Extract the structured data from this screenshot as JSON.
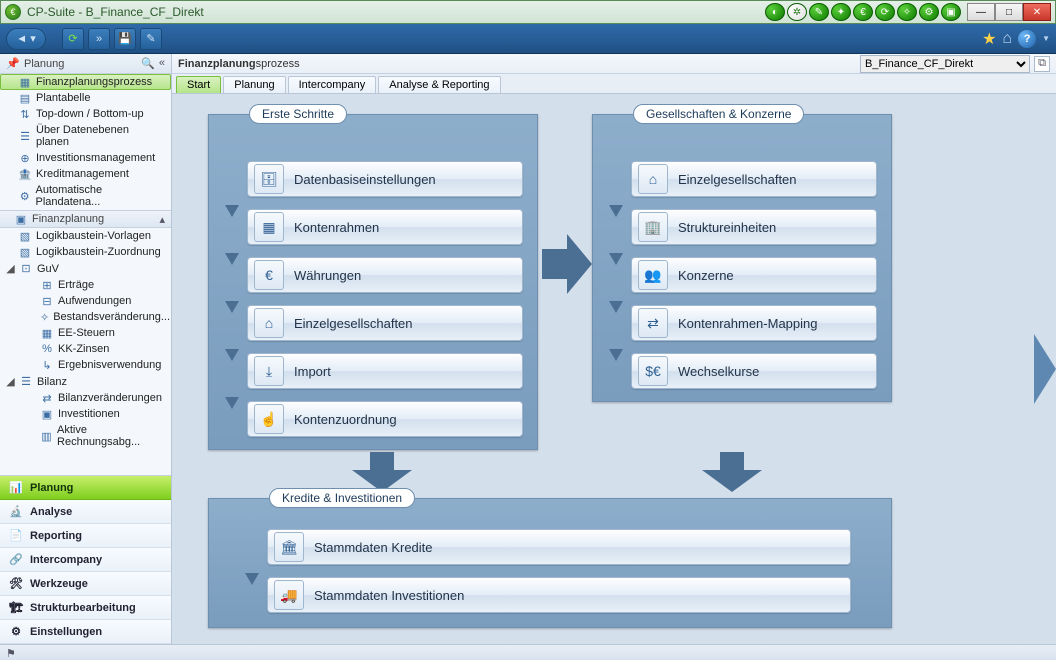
{
  "window": {
    "title": "CP-Suite - B_Finance_CF_Direkt"
  },
  "toolbar_icons": {
    "star": "★",
    "home": "⌂",
    "help": "?"
  },
  "sidebar": {
    "header": "Planung",
    "items": [
      {
        "label": "Finanzplanungsprozess",
        "selected": true,
        "icon": "process"
      },
      {
        "label": "Plantabelle",
        "icon": "table"
      },
      {
        "label": "Top-down / Bottom-up",
        "icon": "updown"
      },
      {
        "label": "Über Datenebenen planen",
        "icon": "layers"
      },
      {
        "label": "Investitionsmanagement",
        "icon": "invest"
      },
      {
        "label": "Kreditmanagement",
        "icon": "credit"
      },
      {
        "label": "Automatische Plandatena...",
        "icon": "auto"
      }
    ],
    "group2": {
      "header": "Finanzplanung",
      "items": [
        {
          "label": "Logikbaustein-Vorlagen",
          "icon": "block"
        },
        {
          "label": "Logikbaustein-Zuordnung",
          "icon": "block"
        },
        {
          "label": "GuV",
          "expanded": true,
          "children": [
            {
              "label": "Erträge",
              "icon": "plus"
            },
            {
              "label": "Aufwendungen",
              "icon": "minus"
            },
            {
              "label": "Bestandsveränderung...",
              "icon": "delta"
            },
            {
              "label": "EE-Steuern",
              "icon": "tax"
            },
            {
              "label": "KK-Zinsen",
              "icon": "interest"
            },
            {
              "label": "Ergebnisverwendung",
              "icon": "result"
            }
          ]
        },
        {
          "label": "Bilanz",
          "expanded": true,
          "children": [
            {
              "label": "Bilanzveränderungen",
              "icon": "chg"
            },
            {
              "label": "Investitionen",
              "icon": "inv"
            },
            {
              "label": "Aktive Rechnungsabg...",
              "icon": "active"
            }
          ]
        }
      ]
    },
    "nav": [
      {
        "label": "Planung",
        "active": true
      },
      {
        "label": "Analyse"
      },
      {
        "label": "Reporting"
      },
      {
        "label": "Intercompany"
      },
      {
        "label": "Werkzeuge"
      },
      {
        "label": "Strukturbearbeitung"
      },
      {
        "label": "Einstellungen"
      }
    ]
  },
  "content": {
    "breadcrumb_strong": "Finanzplanung",
    "breadcrumb_rest": "sprozess",
    "selector": "B_Finance_CF_Direkt",
    "tabs": [
      {
        "label": "Start",
        "active": true
      },
      {
        "label": "Planung"
      },
      {
        "label": "Intercompany"
      },
      {
        "label": "Analyse & Reporting"
      }
    ],
    "panels": {
      "erste": {
        "title": "Erste Schritte",
        "steps": [
          "Datenbasiseinstellungen",
          "Kontenrahmen",
          "Währungen",
          "Einzelgesellschaften",
          "Import",
          "Kontenzuordnung"
        ]
      },
      "ges": {
        "title": "Gesellschaften & Konzerne",
        "steps": [
          "Einzelgesellschaften",
          "Struktureinheiten",
          "Konzerne",
          "Kontenrahmen-Mapping",
          "Wechselkurse"
        ]
      },
      "kredit": {
        "title": "Kredite & Investitionen",
        "steps": [
          "Stammdaten Kredite",
          "Stammdaten Investitionen"
        ]
      }
    }
  }
}
